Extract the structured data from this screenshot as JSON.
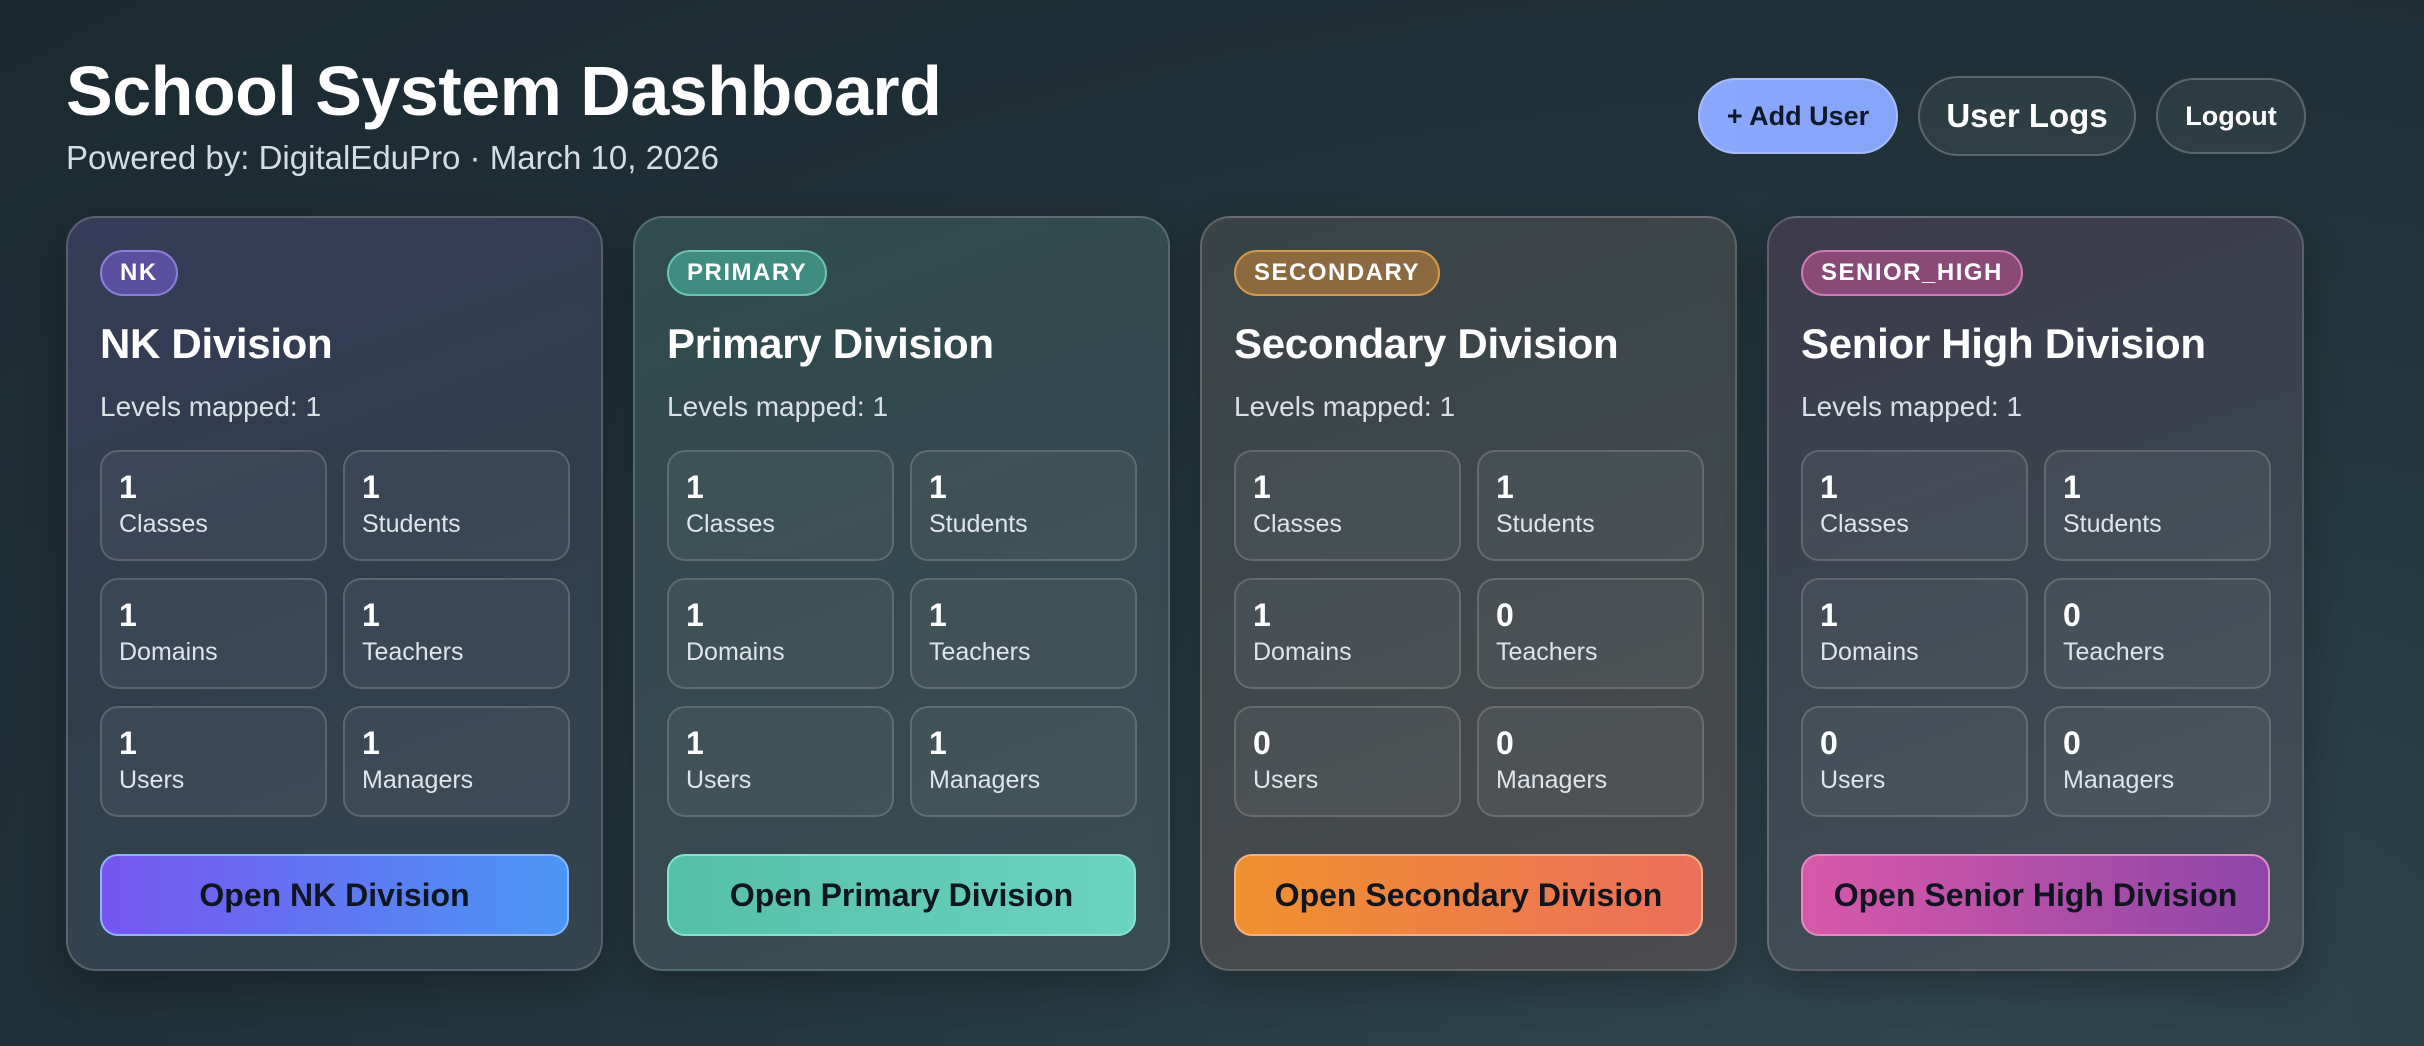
{
  "header": {
    "title": "School System Dashboard",
    "subtitle": "Powered by: DigitalEduPro · March 10, 2026"
  },
  "actions": {
    "add_user": "+ Add User",
    "user_logs": "User Logs",
    "logout": "Logout"
  },
  "colors": {
    "nk_accent": "#7655f0",
    "primary_accent": "#56bfa8",
    "secondary_accent": "#f0902e",
    "senior_accent": "#d858a8",
    "add_user_button": "#8aa8ff"
  },
  "divisions": [
    {
      "badge": "NK",
      "title": "NK Division",
      "levels": "Levels mapped: 1",
      "stats": [
        {
          "value": "1",
          "label": "Classes"
        },
        {
          "value": "1",
          "label": "Students"
        },
        {
          "value": "1",
          "label": "Domains"
        },
        {
          "value": "1",
          "label": "Teachers"
        },
        {
          "value": "1",
          "label": "Users"
        },
        {
          "value": "1",
          "label": "Managers"
        }
      ],
      "button": "Open NK Division"
    },
    {
      "badge": "PRIMARY",
      "title": "Primary Division",
      "levels": "Levels mapped: 1",
      "stats": [
        {
          "value": "1",
          "label": "Classes"
        },
        {
          "value": "1",
          "label": "Students"
        },
        {
          "value": "1",
          "label": "Domains"
        },
        {
          "value": "1",
          "label": "Teachers"
        },
        {
          "value": "1",
          "label": "Users"
        },
        {
          "value": "1",
          "label": "Managers"
        }
      ],
      "button": "Open Primary Division"
    },
    {
      "badge": "SECONDARY",
      "title": "Secondary Division",
      "levels": "Levels mapped: 1",
      "stats": [
        {
          "value": "1",
          "label": "Classes"
        },
        {
          "value": "1",
          "label": "Students"
        },
        {
          "value": "1",
          "label": "Domains"
        },
        {
          "value": "0",
          "label": "Teachers"
        },
        {
          "value": "0",
          "label": "Users"
        },
        {
          "value": "0",
          "label": "Managers"
        }
      ],
      "button": "Open Secondary Division"
    },
    {
      "badge": "SENIOR_HIGH",
      "title": "Senior High Division",
      "levels": "Levels mapped: 1",
      "stats": [
        {
          "value": "1",
          "label": "Classes"
        },
        {
          "value": "1",
          "label": "Students"
        },
        {
          "value": "1",
          "label": "Domains"
        },
        {
          "value": "0",
          "label": "Teachers"
        },
        {
          "value": "0",
          "label": "Users"
        },
        {
          "value": "0",
          "label": "Managers"
        }
      ],
      "button": "Open Senior High Division"
    }
  ]
}
